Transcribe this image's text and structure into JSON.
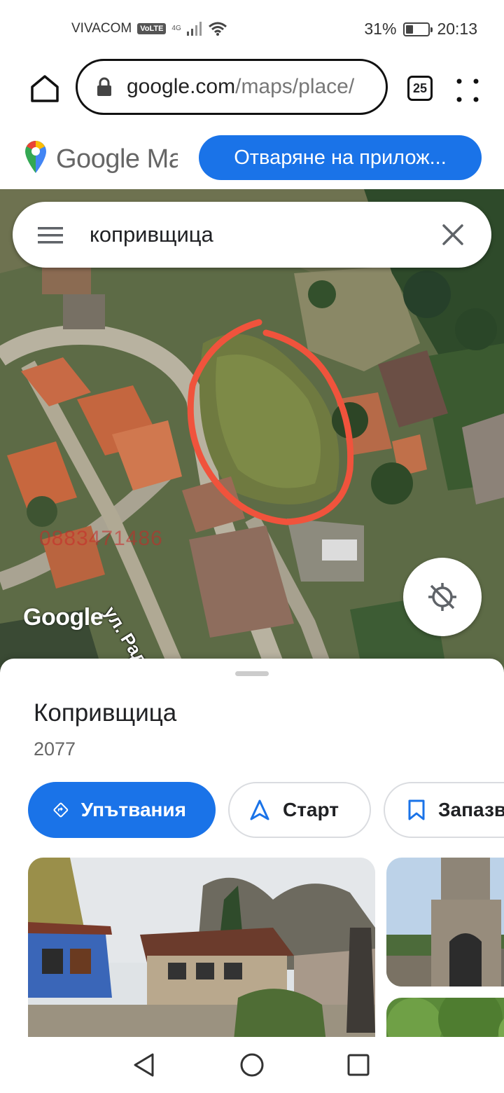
{
  "status_bar": {
    "carrier": "VIVACOM",
    "volte": "VoLTE",
    "network": "4G",
    "battery_percent": "31%",
    "battery_level": 0.31,
    "time": "20:13"
  },
  "browser": {
    "url_domain": "google.com",
    "url_path": "/maps/place/",
    "tab_count": "25"
  },
  "maps_header": {
    "wordmark": "Google Maps",
    "open_app_label": "Отваряне на прилож..."
  },
  "search": {
    "query": "копривщица"
  },
  "map": {
    "google_watermark": "Google",
    "street_label": "ул. Радомире",
    "phone_watermark": "0883471486"
  },
  "place": {
    "title": "Копривщица",
    "subtitle": "2077"
  },
  "actions": {
    "directions_label": "Упътвания",
    "start_label": "Старт",
    "save_label": "Запазв"
  },
  "colors": {
    "accent": "#1a73e8",
    "annotation": "#f0533c"
  }
}
